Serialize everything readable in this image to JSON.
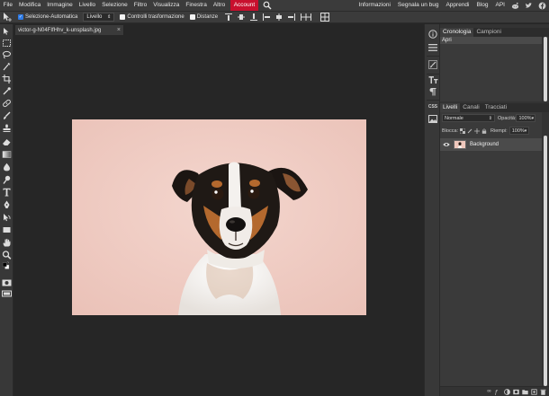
{
  "menubar": {
    "left_items": [
      "File",
      "Modifica",
      "Immagine",
      "Livello",
      "Selezione",
      "Filtro",
      "Visualizza",
      "Finestra",
      "Altro"
    ],
    "account": "Account",
    "right_items": [
      "Informazioni",
      "Segnala un bug",
      "Apprendi",
      "Blog",
      "API"
    ],
    "social_icons": [
      "reddit-icon",
      "twitter-icon",
      "facebook-icon"
    ],
    "account_color": "#c8102e"
  },
  "options": {
    "auto_select_label": "Selezione-Automatica",
    "auto_select_checked": true,
    "layer_select": "Livello",
    "transform_label": "Controlli trasformazione",
    "distances_label": "Distanze"
  },
  "document": {
    "tab_name": "victor-g-N04FIfHhv_k-unsplash.jpg",
    "close": "×"
  },
  "history_panel": {
    "tabs": [
      "Cronologia",
      "Campioni"
    ],
    "active_tab": "Cronologia",
    "items": [
      "Apri"
    ]
  },
  "layers_panel": {
    "tabs": [
      "Livelli",
      "Canali",
      "Tracciati"
    ],
    "active_tab": "Livelli",
    "blend_mode": "Normale",
    "opacity_label": "Opacità:",
    "opacity_value": "100%",
    "lock_label": "Blocca:",
    "fill_label": "Riempi:",
    "fill_value": "100%",
    "layers": [
      {
        "name": "Background",
        "visible": true
      }
    ]
  },
  "colors": {
    "photo_background": "#f0cfc6",
    "foreground": "#000000",
    "background": "#ffffff"
  }
}
